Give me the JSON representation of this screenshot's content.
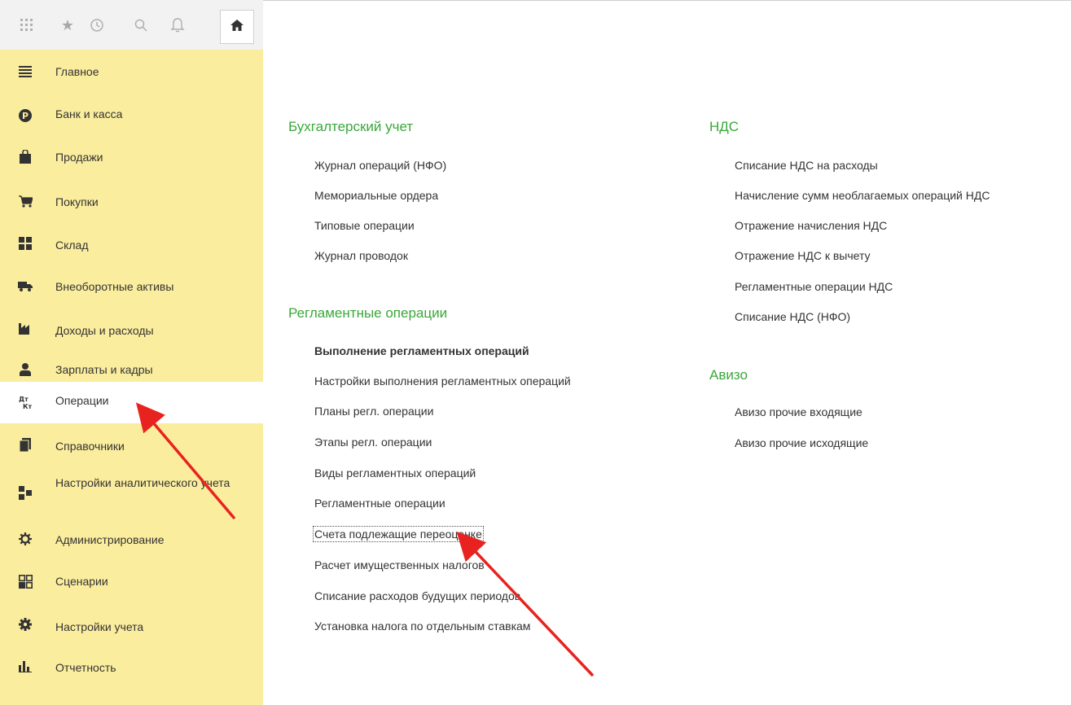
{
  "toolbar": {
    "icons": [
      "apps-icon",
      "star-icon",
      "history-icon",
      "search-icon",
      "bell-icon",
      "home-icon"
    ]
  },
  "sidebar": {
    "items": [
      {
        "label": "Главное",
        "icon": "menu-icon"
      },
      {
        "label": "Банк и касса",
        "icon": "ruble-icon"
      },
      {
        "label": "Продажи",
        "icon": "shopping-bag-icon"
      },
      {
        "label": "Покупки",
        "icon": "cart-icon"
      },
      {
        "label": "Склад",
        "icon": "warehouse-icon"
      },
      {
        "label": "Внеоборотные активы",
        "icon": "truck-icon"
      },
      {
        "label": "Доходы и расходы",
        "icon": "factory-icon"
      },
      {
        "label": "Зарплаты и кадры",
        "icon": "person-icon"
      },
      {
        "label": "Операции",
        "icon": "dt-kt-icon",
        "icon_text": "Дт\nКт",
        "active": true
      },
      {
        "label": "Справочники",
        "icon": "books-icon"
      },
      {
        "label": "Настройки аналитического учета",
        "icon": "analytics-settings-icon"
      },
      {
        "label": "Администрирование",
        "icon": "gear-icon"
      },
      {
        "label": "Сценарии",
        "icon": "scenarios-icon"
      },
      {
        "label": "Настройки учета",
        "icon": "cog-icon"
      },
      {
        "label": "Отчетность",
        "icon": "bar-chart-icon"
      }
    ]
  },
  "content": {
    "accounting": {
      "title": "Бухгалтерский учет",
      "links": [
        "Журнал операций (НФО)",
        "Мемориальные ордера",
        "Типовые операции",
        "Журнал проводок"
      ]
    },
    "regulated": {
      "title": "Регламентные операции",
      "links": [
        "Выполнение регламентных операций",
        "Настройки выполнения регламентных операций",
        "Планы регл. операции",
        "Этапы регл. операции",
        "Виды регламентных операций",
        "Регламентные операции",
        "Счета подлежащие переоценке",
        "Расчет имущественных налогов",
        "Списание расходов будущих периодов",
        "Установка налога по отдельным ставкам"
      ]
    },
    "vat": {
      "title": "НДС",
      "links": [
        "Списание НДС на расходы",
        "Начисление сумм необлагаемых операций НДС",
        "Отражение начисления НДС",
        "Отражение НДС к вычету",
        "Регламентные операции НДС",
        "Списание НДС (НФО)"
      ]
    },
    "aviso": {
      "title": "Авизо",
      "links": [
        "Авизо прочие входящие",
        "Авизо прочие исходящие"
      ]
    }
  },
  "colors": {
    "sidebar_bg": "#fbed9e",
    "section_title": "#3aa83a",
    "arrow": "#e8231f"
  }
}
